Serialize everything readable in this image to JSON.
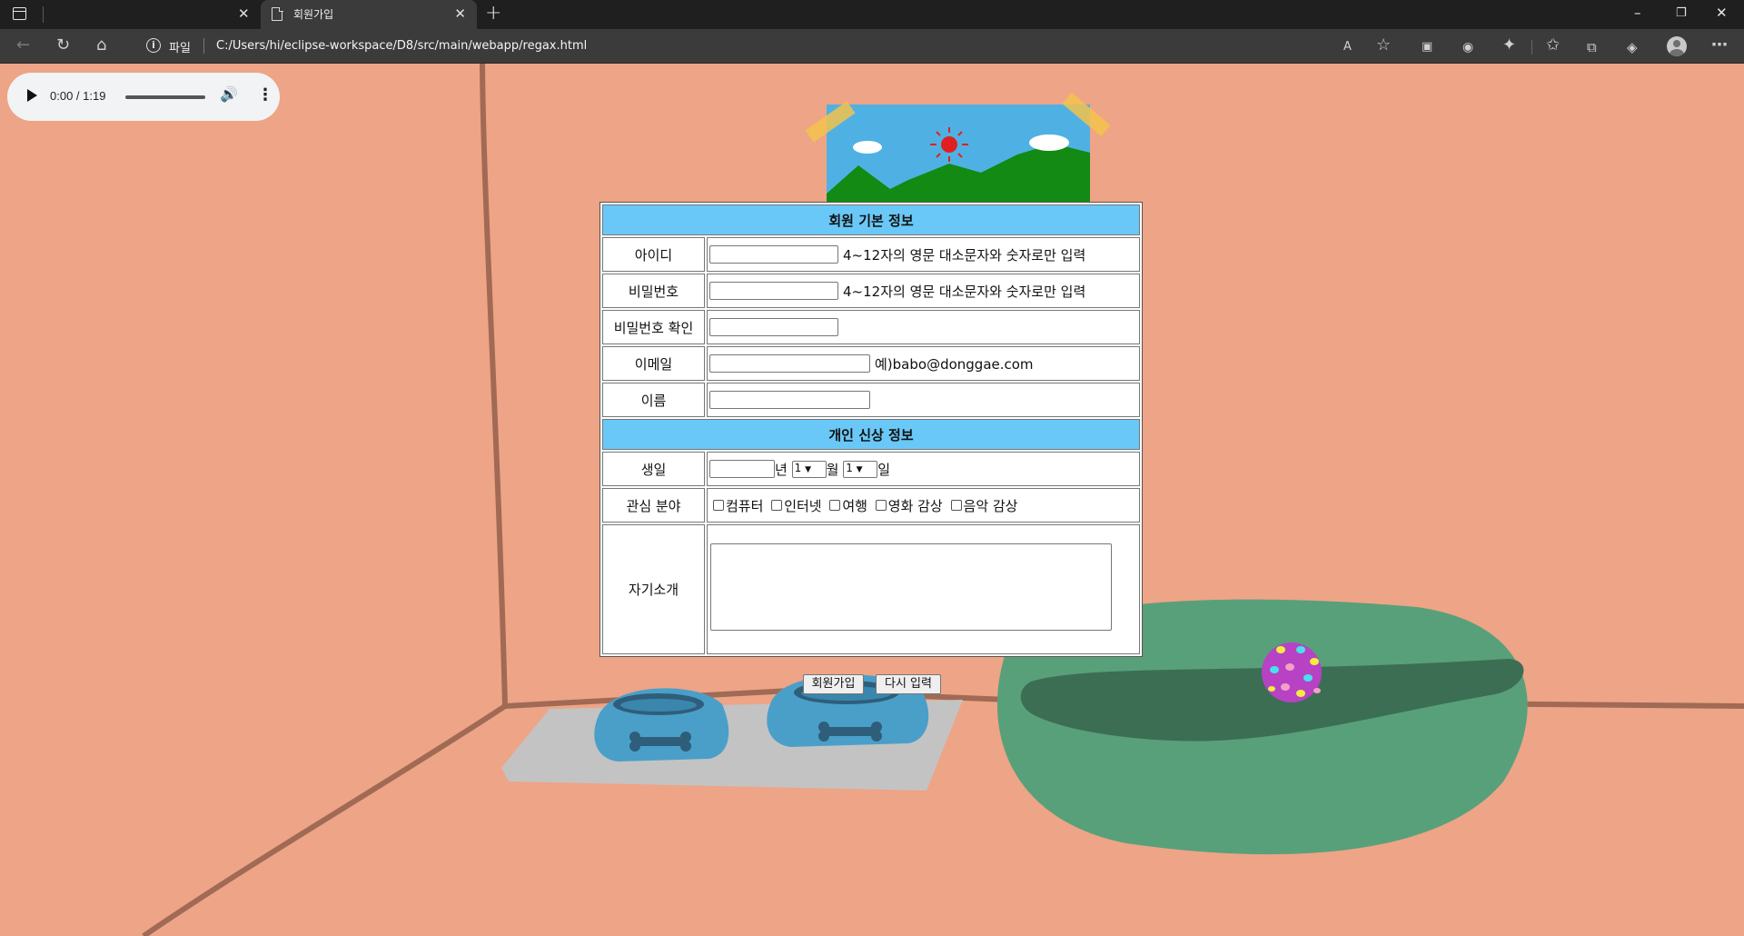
{
  "browser": {
    "active_tab_title": "회원가입",
    "address_scheme": "파일",
    "address_url": "C:/Users/hi/eclipse-workspace/D8/src/main/webapp/regax.html"
  },
  "audio": {
    "time": "0:00 / 1:19"
  },
  "form": {
    "basic_header": "회원 기본 정보",
    "personal_header": "개인 신상 정보",
    "id_label": "아이디",
    "id_hint": "4~12자의 영문 대소문자와 숫자로만 입력",
    "pw_label": "비밀번호",
    "pw_hint": "4~12자의 영문 대소문자와 숫자로만 입력",
    "pw_confirm_label": "비밀번호 확인",
    "email_label": "이메일",
    "email_hint": "예)babo@donggae.com",
    "name_label": "이름",
    "birth_label": "생일",
    "year_unit": "년",
    "month_value": "1",
    "month_unit": "월",
    "day_value": "1",
    "day_unit": "일",
    "interest_label": "관심 분야",
    "interests": [
      "컴퓨터",
      "인터넷",
      "여행",
      "영화 감상",
      "음악 감상"
    ],
    "intro_label": "자기소개",
    "submit_label": "회원가입",
    "reset_label": "다시 입력"
  }
}
